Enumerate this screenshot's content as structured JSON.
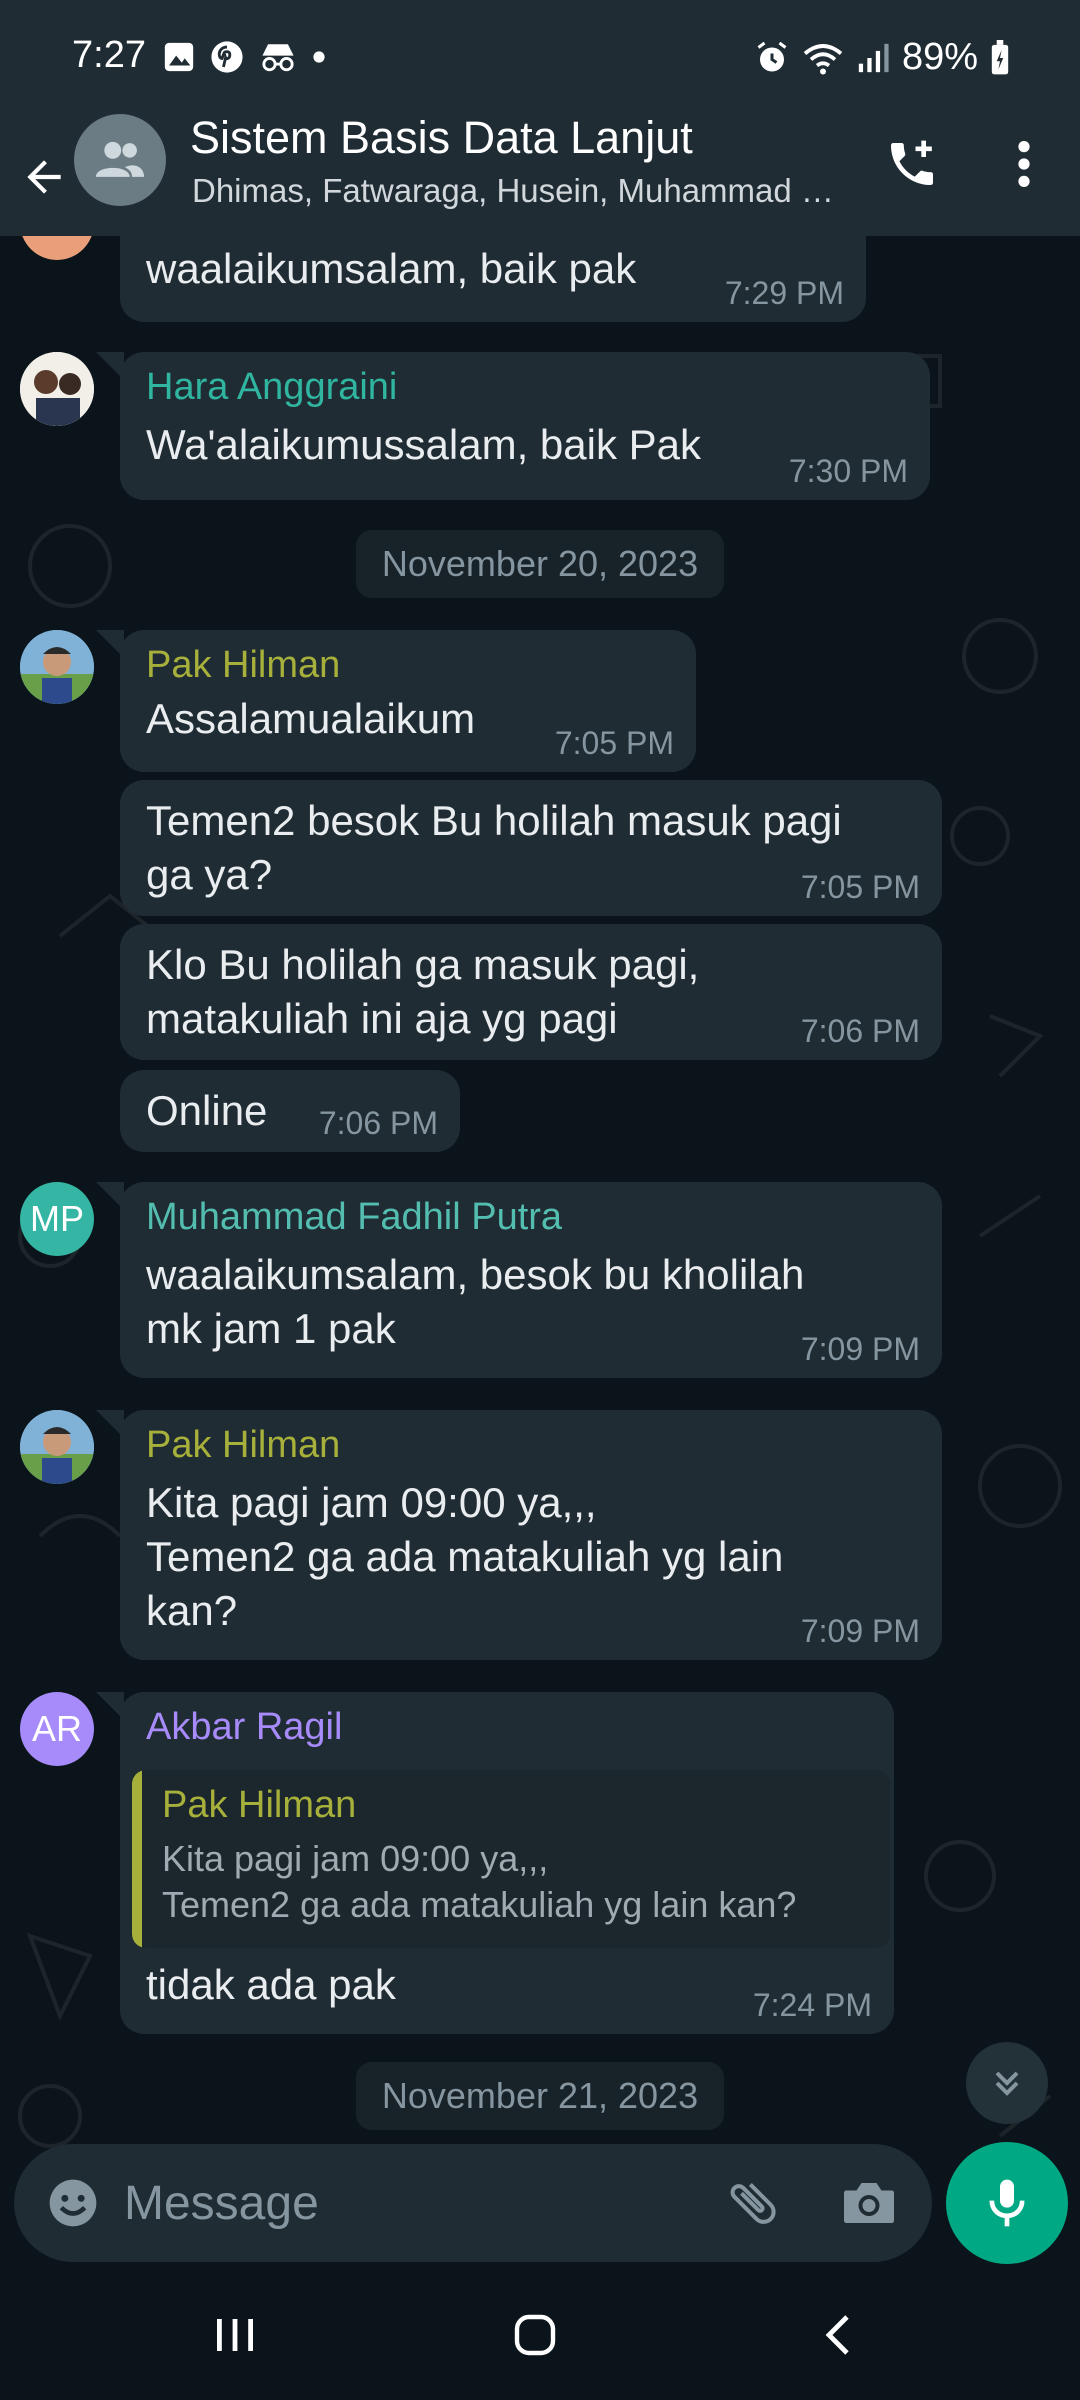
{
  "status_bar": {
    "time": "7:27",
    "battery": "89%"
  },
  "header": {
    "title": "Sistem Basis Data Lanjut",
    "subtitle": "Dhimas, Fatwaraga, Husein, Muhammad Fadhil Putra"
  },
  "messages": [
    {
      "text": "waalaikumsalam, baik pak",
      "time": "7:29 PM"
    },
    {
      "sender": "Hara Anggraini",
      "text": "Wa'alaikumussalam, baik Pak",
      "time": "7:30 PM"
    },
    {
      "sender": "Pak Hilman",
      "text": "Assalamualaikum",
      "time": "7:05 PM"
    },
    {
      "text": "Temen2 besok Bu holilah masuk pagi\nga ya?",
      "time": "7:05 PM"
    },
    {
      "text": "Klo Bu holilah ga masuk pagi,\nmatakuliah ini aja yg pagi",
      "time": "7:06 PM"
    },
    {
      "text": "Online",
      "time": "7:06 PM"
    },
    {
      "sender": "Muhammad Fadhil Putra",
      "avatar_initials": "MP",
      "text": "waalaikumsalam, besok bu kholilah\nmk jam 1 pak",
      "time": "7:09 PM"
    },
    {
      "sender": "Pak Hilman",
      "text": "Kita pagi jam 09:00 ya,,,\nTemen2 ga ada matakuliah yg lain\nkan?",
      "time": "7:09 PM"
    },
    {
      "sender": "Akbar Ragil",
      "avatar_initials": "AR",
      "quote_sender": "Pak Hilman",
      "quote_text": "Kita pagi jam 09:00 ya,,,\nTemen2 ga ada matakuliah yg lain kan?",
      "text": "tidak ada pak",
      "time": "7:24 PM"
    }
  ],
  "date_chips": [
    "November 20, 2023",
    "November 21, 2023"
  ],
  "composer": {
    "placeholder": "Message"
  },
  "colors": {
    "background": "#0b141a",
    "bar": "#1f2c34",
    "bubble": "#202c33",
    "accent": "#00a884",
    "sender_hara": "#2fb5a0",
    "sender_hilman": "#a6b03a",
    "sender_fadhil": "#53bdb0",
    "sender_akbar": "#a78bfa"
  },
  "icons": [
    "back-arrow-icon",
    "group-icon",
    "add-call-icon",
    "more-vert-icon",
    "emoji-icon",
    "attach-icon",
    "camera-icon",
    "mic-icon",
    "double-chevron-down-icon",
    "recents-icon",
    "home-icon",
    "back-nav-icon"
  ]
}
